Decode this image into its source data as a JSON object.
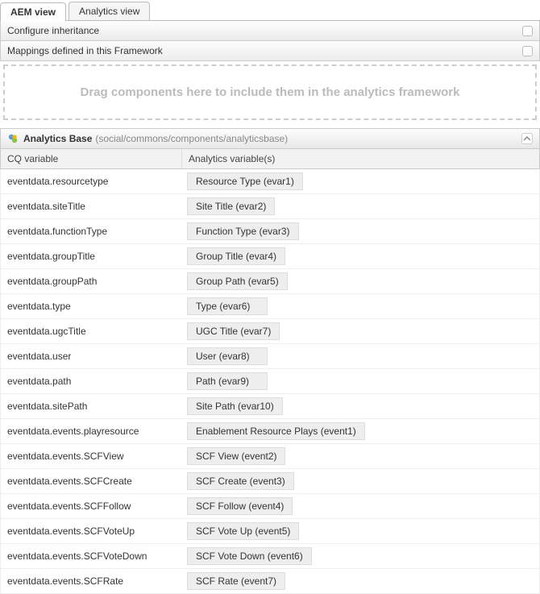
{
  "tabs": {
    "aem": "AEM view",
    "analytics": "Analytics view"
  },
  "sections": {
    "configure": "Configure inheritance",
    "mappings": "Mappings defined in this Framework"
  },
  "dropzone": "Drag components here to include them in the analytics framework",
  "panel": {
    "title": "Analytics Base",
    "subtitle": "(social/commons/components/analyticsbase)"
  },
  "columns": {
    "cq": "CQ variable",
    "av": "Analytics variable(s)"
  },
  "rows": [
    {
      "cq": "eventdata.resourcetype",
      "av": "Resource Type (evar1)",
      "wide": false
    },
    {
      "cq": "eventdata.siteTitle",
      "av": "Site Title (evar2)",
      "wide": false
    },
    {
      "cq": "eventdata.functionType",
      "av": "Function Type (evar3)",
      "wide": false
    },
    {
      "cq": "eventdata.groupTitle",
      "av": "Group Title (evar4)",
      "wide": false
    },
    {
      "cq": "eventdata.groupPath",
      "av": "Group Path (evar5)",
      "wide": false
    },
    {
      "cq": "eventdata.type",
      "av": "Type (evar6)",
      "wide": false
    },
    {
      "cq": "eventdata.ugcTitle",
      "av": "UGC Title (evar7)",
      "wide": false
    },
    {
      "cq": "eventdata.user",
      "av": "User (evar8)",
      "wide": false
    },
    {
      "cq": "eventdata.path",
      "av": "Path (evar9)",
      "wide": false
    },
    {
      "cq": "eventdata.sitePath",
      "av": "Site Path (evar10)",
      "wide": false
    },
    {
      "cq": "eventdata.events.playresource",
      "av": "Enablement Resource Plays (event1)",
      "wide": true
    },
    {
      "cq": "eventdata.events.SCFView",
      "av": "SCF View (event2)",
      "wide": false
    },
    {
      "cq": "eventdata.events.SCFCreate",
      "av": "SCF Create (event3)",
      "wide": false
    },
    {
      "cq": "eventdata.events.SCFFollow",
      "av": "SCF Follow (event4)",
      "wide": false
    },
    {
      "cq": "eventdata.events.SCFVoteUp",
      "av": "SCF Vote Up (event5)",
      "wide": false
    },
    {
      "cq": "eventdata.events.SCFVoteDown",
      "av": "SCF Vote Down (event6)",
      "wide": false
    },
    {
      "cq": "eventdata.events.SCFRate",
      "av": "SCF Rate (event7)",
      "wide": false
    }
  ]
}
